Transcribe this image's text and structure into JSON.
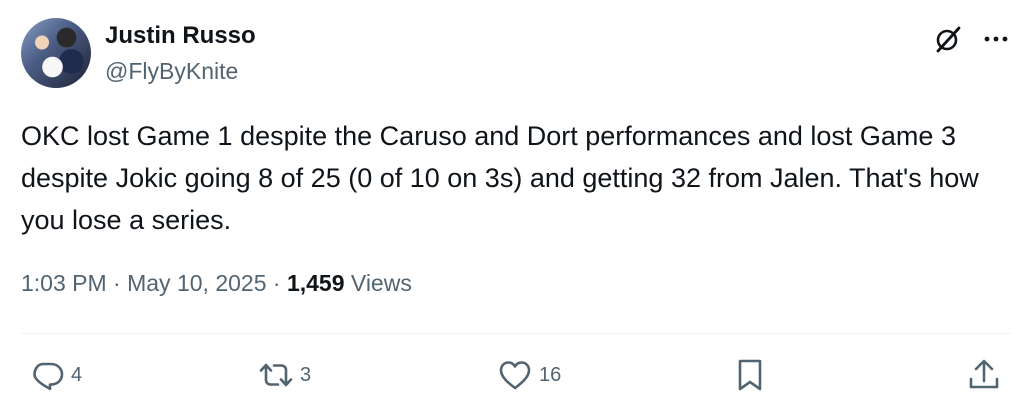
{
  "author": {
    "name": "Justin Russo",
    "handle": "@FlyByKnite"
  },
  "icons": {
    "grok": "grok-icon",
    "more": "more-icon"
  },
  "tweet": {
    "text": "OKC lost Game 1 despite the Caruso and Dort performances and lost Game 3 despite Jokic going 8 of 25 (0 of 10 on 3s) and getting 32 from Jalen. That's how you lose a series."
  },
  "meta": {
    "time": "1:03 PM",
    "separator": " · ",
    "date": "May 10, 2025",
    "views_count": "1,459",
    "views_label": " Views"
  },
  "actions": {
    "replies": "4",
    "reposts": "3",
    "likes": "16"
  },
  "colors": {
    "text": "#0f1419",
    "secondary": "#536471",
    "divider": "#eff3f4"
  }
}
